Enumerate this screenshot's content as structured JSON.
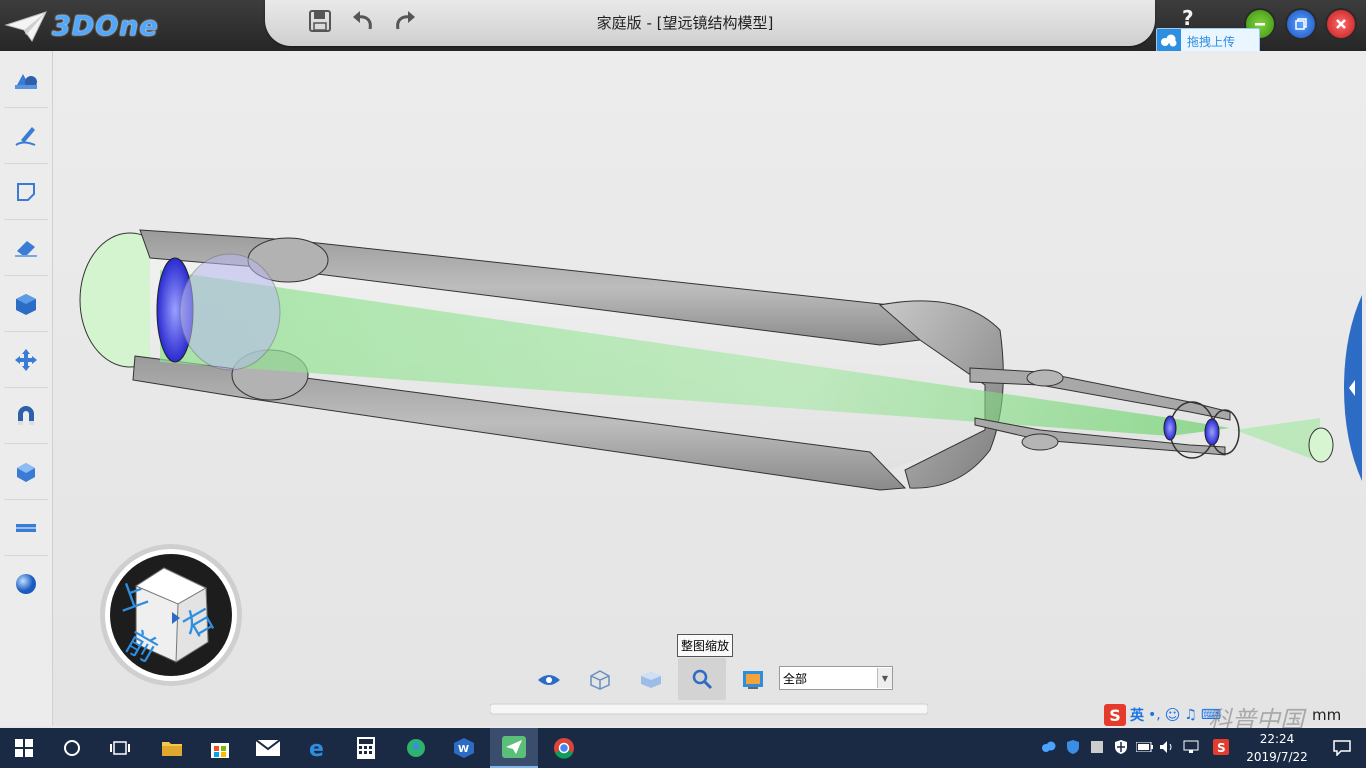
{
  "app": {
    "name": "3DOne",
    "window_title": "家庭版 - [望远镜结构模型]"
  },
  "titlebar": {
    "save_icon": "save-icon",
    "undo_icon": "undo-icon",
    "redo_icon": "redo-icon",
    "help_label": "?",
    "upload_label": "拖拽上传",
    "controls": [
      "minimize-icon",
      "restore-icon",
      "close-icon"
    ]
  },
  "left_toolbar": {
    "items": [
      {
        "name": "basic-solid",
        "icon": "solid-shapes-icon"
      },
      {
        "name": "sketch",
        "icon": "sketch-pen-icon"
      },
      {
        "name": "sketch-edit",
        "icon": "sketch-edit-icon"
      },
      {
        "name": "special-feature",
        "icon": "eraser-feature-icon"
      },
      {
        "name": "combine",
        "icon": "cube-icon"
      },
      {
        "name": "basic-edit",
        "icon": "move-arrows-icon"
      },
      {
        "name": "adsorb",
        "icon": "magnet-icon"
      },
      {
        "name": "group",
        "icon": "group-cube-icon"
      },
      {
        "name": "distance-measure",
        "icon": "ruler-icon"
      },
      {
        "name": "material-render",
        "icon": "sphere-icon"
      }
    ]
  },
  "viewcube": {
    "top_label": "上",
    "front_label": "前",
    "right_label": "右"
  },
  "bottom_toolbar": {
    "buttons": [
      {
        "name": "view-visibility",
        "icon": "eye-icon"
      },
      {
        "name": "wireframe-view",
        "icon": "wire-cube-icon"
      },
      {
        "name": "shaded-view",
        "icon": "solid-cube-icon"
      },
      {
        "name": "fit-all",
        "icon": "zoom-search-icon"
      },
      {
        "name": "render-mode",
        "icon": "picture-icon"
      }
    ],
    "tooltip": "整图缩放",
    "scope_select": {
      "value": "全部"
    },
    "unit": "mm"
  },
  "ime": {
    "mode": "英",
    "brand": "S"
  },
  "watermark": "科普中国",
  "taskbar": {
    "time": "22:24",
    "date": "2019/7/22",
    "apps": [
      "windows-start-icon",
      "cortana-search-icon",
      "task-view-icon",
      "file-explorer-icon",
      "store-icon",
      "mail-icon",
      "edge-icon",
      "calculator-icon",
      "app-icon",
      "wps-icon",
      "3done-taskbar-icon",
      "chrome-icon"
    ]
  },
  "colors": {
    "accent": "#2e8ee0",
    "lens": "#3b3bd9",
    "beam": "#7cdc7c",
    "tube": "#b5b5b5"
  }
}
